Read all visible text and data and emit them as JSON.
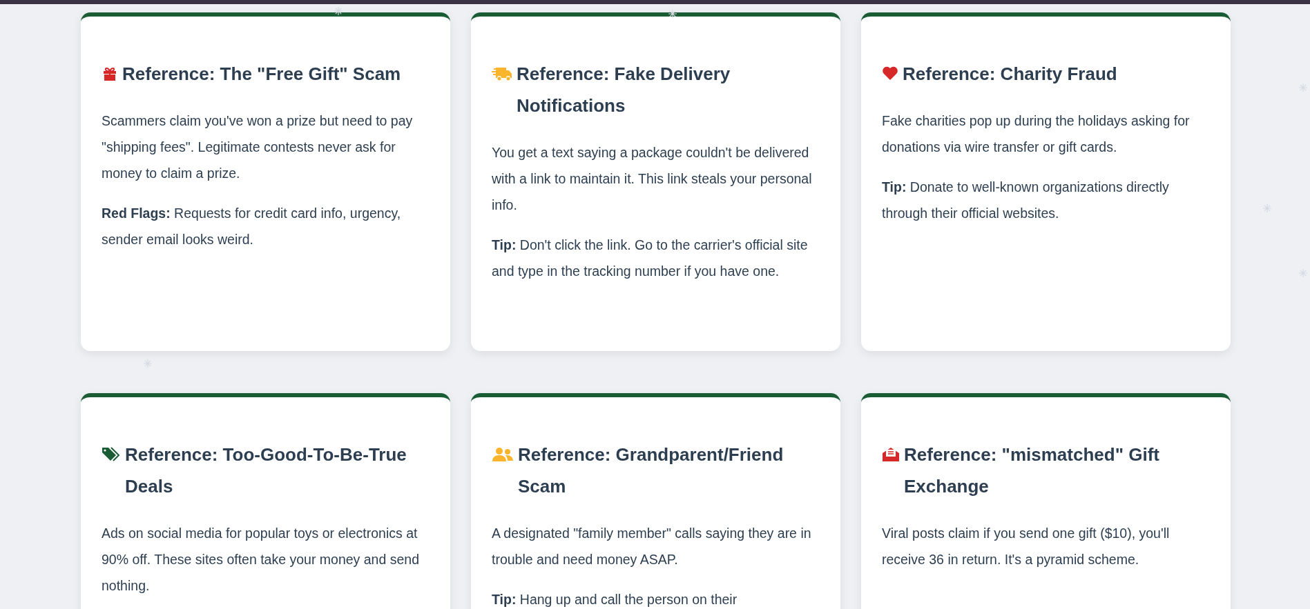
{
  "cards": [
    {
      "kind": "gift",
      "title": "Reference: The \"Free Gift\" Scam",
      "paragraphs": [
        "Scammers claim you've won a prize but need to pay \"shipping fees\". Legitimate contests never ask for money to claim a prize.",
        "**Red Flags:** Requests for credit card info, urgency, sender email looks weird."
      ]
    },
    {
      "kind": "truck",
      "title": "Reference: Fake Delivery Notifications",
      "paragraphs": [
        "You get a text saying a package couldn't be delivered with a link to maintain it. This link steals your personal info.",
        "**Tip:** Don't click the link. Go to the carrier's official site and type in the tracking number if you have one."
      ]
    },
    {
      "kind": "heart",
      "title": "Reference: Charity Fraud",
      "paragraphs": [
        "Fake charities pop up during the holidays asking for donations via wire transfer or gift cards.",
        "**Tip:** Donate to well-known organizations directly through their official websites."
      ]
    },
    {
      "kind": "tags",
      "title": "Reference: Too-Good-To-Be-True Deals",
      "paragraphs": [
        "Ads on social media for popular toys or electronics at 90% off. These sites often take your money and send nothing."
      ]
    },
    {
      "kind": "users",
      "title": "Reference: Grandparent/Friend Scam",
      "paragraphs": [
        "A designated \"family member\" calls saying they are in trouble and need money ASAP.",
        "**Tip:** Hang up and call the person on their"
      ]
    },
    {
      "kind": "envelope",
      "title": "Reference: \"mismatched\" Gift Exchange",
      "paragraphs": [
        "Viral posts claim if you send one gift ($10), you'll receive 36 in return. It's a pyramid scheme."
      ]
    }
  ]
}
